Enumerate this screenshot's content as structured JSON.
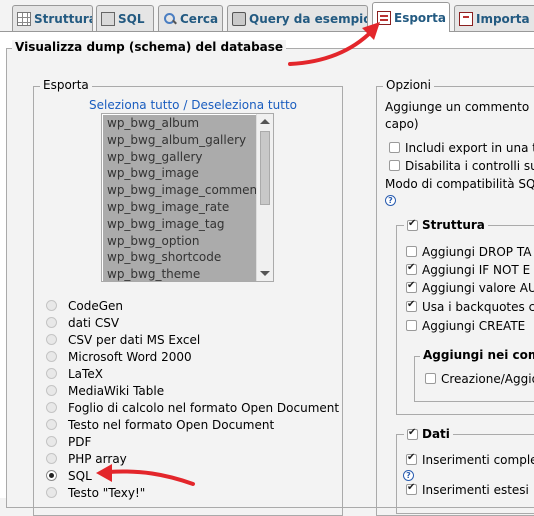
{
  "tabs": [
    {
      "label": "Struttura",
      "icon": "table-structure-icon"
    },
    {
      "label": "SQL",
      "icon": "sql-icon"
    },
    {
      "label": "Cerca",
      "icon": "search-icon"
    },
    {
      "label": "Query da esempio",
      "icon": "query-icon"
    },
    {
      "label": "Esporta",
      "icon": "export-icon",
      "active": true
    },
    {
      "label": "Importa",
      "icon": "import-icon"
    }
  ],
  "main": {
    "legend": "Visualizza dump (schema) del database"
  },
  "esporta": {
    "legend": "Esporta",
    "select_all_link": "Seleziona tutto / Deseleziona tutto",
    "tables": [
      "wp_bwg_album",
      "wp_bwg_album_gallery",
      "wp_bwg_gallery",
      "wp_bwg_image",
      "wp_bwg_image_comment",
      "wp_bwg_image_rate",
      "wp_bwg_image_tag",
      "wp_bwg_option",
      "wp_bwg_shortcode",
      "wp_bwg_theme"
    ],
    "formats": [
      {
        "label": "CodeGen",
        "selected": false
      },
      {
        "label": "dati CSV",
        "selected": false
      },
      {
        "label": "CSV per dati MS Excel",
        "selected": false
      },
      {
        "label": "Microsoft Word 2000",
        "selected": false
      },
      {
        "label": "LaTeX",
        "selected": false
      },
      {
        "label": "MediaWiki Table",
        "selected": false
      },
      {
        "label": "Foglio di calcolo nel formato Open Document",
        "selected": false
      },
      {
        "label": "Testo nel formato Open Document",
        "selected": false
      },
      {
        "label": "PDF",
        "selected": false
      },
      {
        "label": "PHP array",
        "selected": false
      },
      {
        "label": "SQL",
        "selected": true
      },
      {
        "label": "Testo \"Texy!\"",
        "selected": false
      }
    ]
  },
  "opzioni": {
    "legend": "Opzioni",
    "comment_line1": "Aggiunge un commento p",
    "comment_line2": "capo)",
    "include_export": "Includi export in una tr",
    "disable_checks": "Disabilita i controlli sul",
    "compat_mode": "Modo di compatibilità SQL",
    "struttura": {
      "legend": "Struttura",
      "checked": true,
      "items": [
        {
          "label": "Aggiungi DROP TA",
          "checked": false
        },
        {
          "label": "Aggiungi IF NOT E",
          "checked": true
        },
        {
          "label": "Aggiungi valore AU",
          "checked": true
        },
        {
          "label": "Usa i backquotes c",
          "checked": true
        },
        {
          "label": "Aggiungi CREATE",
          "checked": false
        }
      ],
      "nested_legend": "Aggiungi nei com",
      "nested_item": "Creazione/Aggio"
    },
    "dati": {
      "legend": "Dati",
      "checked": true,
      "items": [
        {
          "label": "Inserimenti complet",
          "checked": true
        },
        {
          "label": "Inserimenti estesi",
          "checked": true
        }
      ]
    }
  },
  "colors": {
    "accent_tab_text": "#235a81",
    "link": "#1a5dbf",
    "annotation_arrow": "#e3262b"
  }
}
